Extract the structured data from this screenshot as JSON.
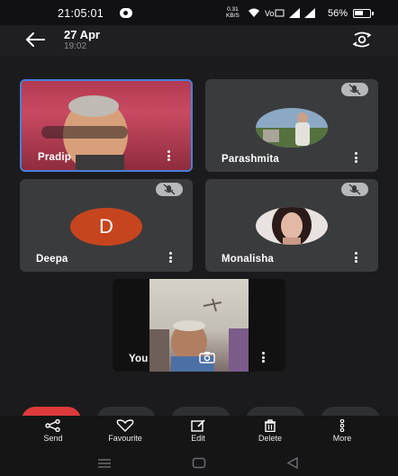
{
  "status_bar": {
    "time": "21:05:01",
    "net_speed_value": "0.31",
    "net_speed_unit": "KB/S",
    "battery": "56%"
  },
  "header": {
    "date": "27 Apr",
    "time": "19:02",
    "back_icon": "arrow-left-icon",
    "switch_camera_icon": "switch-camera-icon"
  },
  "participants": [
    {
      "name": "Pradip",
      "type": "video",
      "muted": false,
      "active_speaker": true
    },
    {
      "name": "Parashmita",
      "type": "photo",
      "muted": true
    },
    {
      "name": "Deepa",
      "type": "initial",
      "initial": "D",
      "avatar_color": "#c7451e",
      "muted": true
    },
    {
      "name": "Monalisha",
      "type": "photo",
      "muted": true
    },
    {
      "name": "You",
      "type": "video",
      "self": true
    }
  ],
  "actions": [
    {
      "label": "Send",
      "icon": "share-icon"
    },
    {
      "label": "Favourite",
      "icon": "heart-icon"
    },
    {
      "label": "Edit",
      "icon": "edit-icon"
    },
    {
      "label": "Delete",
      "icon": "trash-icon"
    },
    {
      "label": "More",
      "icon": "more-vertical-icon"
    }
  ],
  "colors": {
    "active_border": "#4a7fd6",
    "tile_bg": "#3a3b3d",
    "end_call": "#dc3a3b"
  }
}
